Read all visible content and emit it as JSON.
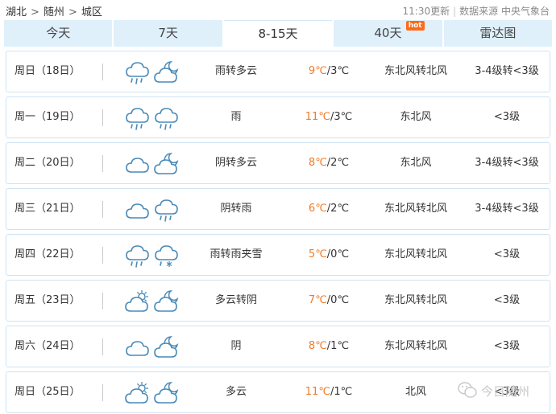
{
  "breadcrumb": {
    "province": "湖北",
    "separator": ">",
    "city": "随州",
    "district": "城区"
  },
  "update": {
    "time": "11:30更新",
    "source": "数据来源 中央气象台"
  },
  "tabs": [
    {
      "label": "今天"
    },
    {
      "label": "7天"
    },
    {
      "label": "8-15天",
      "active": true
    },
    {
      "label": "40天",
      "badge": "hot"
    },
    {
      "label": "雷达图"
    }
  ],
  "colors": {
    "tab_bg": "#dff0fb",
    "high_temp": "#f07b2a",
    "row_border": "#cfe3f2",
    "icon_stroke": "#4a8ab8",
    "hot_badge": "#ff6a1a"
  },
  "forecast": [
    {
      "day": "周日（18日）",
      "icon_day": "rain-icon",
      "icon_night": "moon-cloud-icon",
      "desc": "雨转多云",
      "high": "9℃",
      "low": "/3℃",
      "wind": "东北风转北风",
      "level": "3-4级转<3级"
    },
    {
      "day": "周一（19日）",
      "icon_day": "rain-icon",
      "icon_night": "rain-icon",
      "desc": "雨",
      "high": "11℃",
      "low": "/3℃",
      "wind": "东北风",
      "level": "<3级"
    },
    {
      "day": "周二（20日）",
      "icon_day": "cloud-icon",
      "icon_night": "moon-cloud-icon",
      "desc": "阴转多云",
      "high": "8℃",
      "low": "/2℃",
      "wind": "东北风",
      "level": "3-4级转<3级"
    },
    {
      "day": "周三（21日）",
      "icon_day": "cloud-icon",
      "icon_night": "rain-icon",
      "desc": "阴转雨",
      "high": "6℃",
      "low": "/2℃",
      "wind": "东北风转北风",
      "level": "3-4级转<3级"
    },
    {
      "day": "周四（22日）",
      "icon_day": "rain-icon",
      "icon_night": "sleet-icon",
      "desc": "雨转雨夹雪",
      "high": "5℃",
      "low": "/0℃",
      "wind": "东北风转北风",
      "level": "<3级"
    },
    {
      "day": "周五（23日）",
      "icon_day": "sun-cloud-icon",
      "icon_night": "moon-cloud-icon",
      "desc": "多云转阴",
      "high": "7℃",
      "low": "/0℃",
      "wind": "东北风转北风",
      "level": "<3级"
    },
    {
      "day": "周六（24日）",
      "icon_day": "cloud-icon",
      "icon_night": "moon-cloud-icon",
      "desc": "阴",
      "high": "8℃",
      "low": "/1℃",
      "wind": "东北风转北风",
      "level": "<3级"
    },
    {
      "day": "周日（25日）",
      "icon_day": "sun-cloud-icon",
      "icon_night": "moon-cloud-icon",
      "desc": "多云",
      "high": "11℃",
      "low": "/1℃",
      "wind": "北风",
      "level": "<3级"
    }
  ],
  "watermark": {
    "text": "今日随州"
  }
}
